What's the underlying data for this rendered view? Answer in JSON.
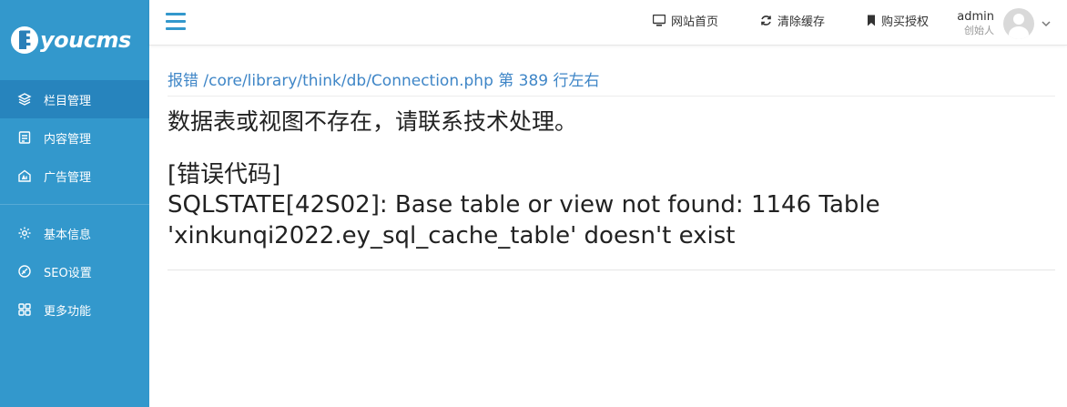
{
  "brand": {
    "logo_text": "youcms",
    "logo_letter": "E"
  },
  "sidebar": {
    "items": [
      {
        "label": "栏目管理",
        "icon": "layers-icon"
      },
      {
        "label": "内容管理",
        "icon": "document-icon"
      },
      {
        "label": "广告管理",
        "icon": "ad-icon"
      },
      {
        "label": "基本信息",
        "icon": "gear-icon"
      },
      {
        "label": "SEO设置",
        "icon": "seo-icon"
      },
      {
        "label": "更多功能",
        "icon": "grid-icon"
      }
    ]
  },
  "topbar": {
    "links": [
      {
        "label": "网站首页",
        "icon": "monitor-icon"
      },
      {
        "label": "清除缓存",
        "icon": "refresh-icon"
      },
      {
        "label": "购买授权",
        "icon": "bookmark-icon"
      }
    ],
    "user": {
      "name": "admin",
      "role": "创始人"
    }
  },
  "error": {
    "location": "报错 /core/library/think/db/Connection.php 第 389 行左右",
    "message": "数据表或视图不存在，请联系技术处理。",
    "code_title": "[错误代码]",
    "code_line1": "SQLSTATE[42S02]: Base table or view not found: 1146 Table",
    "code_line2": "'xinkunqi2022.ey_sql_cache_table' doesn't exist"
  },
  "colors": {
    "sidebar": "#3398cc",
    "sidebar_active": "#2784bd",
    "link": "#3f86c7"
  }
}
